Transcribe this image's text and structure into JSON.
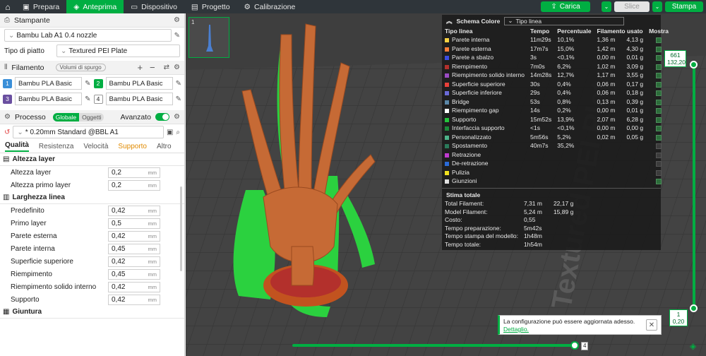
{
  "topbar": {
    "tabs": [
      {
        "label": "Prepara",
        "icon": "cube-icon"
      },
      {
        "label": "Anteprima",
        "icon": "layers-icon",
        "active": true
      },
      {
        "label": "Dispositivo",
        "icon": "monitor-icon"
      },
      {
        "label": "Progetto",
        "icon": "folder-icon"
      },
      {
        "label": "Calibrazione",
        "icon": "gear-icon"
      }
    ],
    "load_label": "Carica",
    "slice_label": "Slice",
    "print_label": "Stampa"
  },
  "printer": {
    "header": "Stampante",
    "name": "Bambu Lab A1 0.4 nozzle",
    "plate_label": "Tipo di piatto",
    "plate_value": "Textured PEI Plate"
  },
  "filament": {
    "header": "Filamento",
    "purge_label": "Volumi di spurgo",
    "items": [
      {
        "num": "1",
        "name": "Bambu PLA Basic",
        "color": "#3a8fd8",
        "text": "#fff"
      },
      {
        "num": "2",
        "name": "Bambu PLA Basic",
        "color": "#00ae42",
        "text": "#fff"
      },
      {
        "num": "3",
        "name": "Bambu PLA Basic",
        "color": "#6a4fa0",
        "text": "#fff"
      },
      {
        "num": "4",
        "name": "Bambu PLA Basic",
        "color": "#ffffff",
        "text": "#222"
      }
    ]
  },
  "process": {
    "header": "Processo",
    "toggle_global": "Globale",
    "toggle_objects": "Oggetti",
    "advanced_label": "Avanzato",
    "preset": "* 0.20mm Standard @BBL A1",
    "tabs": [
      "Qualità",
      "Resistenza",
      "Velocità",
      "Supporto",
      "Altro"
    ],
    "groups": [
      {
        "title": "Altezza layer",
        "rows": [
          {
            "label": "Altezza layer",
            "value": "0,2",
            "unit": "mm"
          },
          {
            "label": "Altezza primo layer",
            "value": "0,2",
            "unit": "mm"
          }
        ]
      },
      {
        "title": "Larghezza linea",
        "rows": [
          {
            "label": "Predefinito",
            "value": "0,42",
            "unit": "mm"
          },
          {
            "label": "Primo layer",
            "value": "0,5",
            "unit": "mm"
          },
          {
            "label": "Parete esterna",
            "value": "0,42",
            "unit": "mm"
          },
          {
            "label": "Parete interna",
            "value": "0,45",
            "unit": "mm"
          },
          {
            "label": "Superficie superiore",
            "value": "0,42",
            "unit": "mm"
          },
          {
            "label": "Riempimento",
            "value": "0,45",
            "unit": "mm"
          },
          {
            "label": "Riempimento solido interno",
            "value": "0,42",
            "unit": "mm"
          },
          {
            "label": "Supporto",
            "value": "0,42",
            "unit": "mm"
          }
        ]
      },
      {
        "title": "Giuntura",
        "rows": []
      }
    ]
  },
  "thumbnail": {
    "num": "1"
  },
  "legend": {
    "title": "Schema Colore",
    "mode": "Tipo linea",
    "headers": [
      "Tipo linea",
      "Tempo",
      "Percentuale",
      "Filamento usato",
      "Mostra"
    ],
    "rows": [
      {
        "name": "Parete interna",
        "color": "#f5d142",
        "time": "11m29s",
        "pct": "10,1%",
        "fil": "1,36 m",
        "g": "4,13 g",
        "show": true
      },
      {
        "name": "Parete esterna",
        "color": "#ff7d38",
        "time": "17m7s",
        "pct": "15,0%",
        "fil": "1,42 m",
        "g": "4,30 g",
        "show": true
      },
      {
        "name": "Parete a sbalzo",
        "color": "#3c4ce0",
        "time": "3s",
        "pct": "<0,1%",
        "fil": "0,00 m",
        "g": "0,01 g",
        "show": true
      },
      {
        "name": "Riempimento",
        "color": "#b3302c",
        "time": "7m0s",
        "pct": "6,2%",
        "fil": "1,02 m",
        "g": "3,09 g",
        "show": true
      },
      {
        "name": "Riempimento solido interno",
        "color": "#9a4bc4",
        "time": "14m28s",
        "pct": "12,7%",
        "fil": "1,17 m",
        "g": "3,55 g",
        "show": true
      },
      {
        "name": "Superficie superiore",
        "color": "#e8403a",
        "time": "30s",
        "pct": "0,4%",
        "fil": "0,06 m",
        "g": "0,17 g",
        "show": true
      },
      {
        "name": "Superficie inferiore",
        "color": "#6a6ad8",
        "time": "29s",
        "pct": "0,4%",
        "fil": "0,06 m",
        "g": "0,18 g",
        "show": true
      },
      {
        "name": "Bridge",
        "color": "#5b87a8",
        "time": "53s",
        "pct": "0,8%",
        "fil": "0,13 m",
        "g": "0,39 g",
        "show": true
      },
      {
        "name": "Riempimento gap",
        "color": "#ffffff",
        "time": "14s",
        "pct": "0,2%",
        "fil": "0,00 m",
        "g": "0,01 g",
        "show": true
      },
      {
        "name": "Supporto",
        "color": "#24c43c",
        "time": "15m52s",
        "pct": "13,9%",
        "fil": "2,07 m",
        "g": "6,28 g",
        "show": true
      },
      {
        "name": "Interfaccia supporto",
        "color": "#1b8a3a",
        "time": "<1s",
        "pct": "<0,1%",
        "fil": "0,00 m",
        "g": "0,00 g",
        "show": true
      },
      {
        "name": "Personalizzato",
        "color": "#4db38a",
        "time": "5m56s",
        "pct": "5,2%",
        "fil": "0,02 m",
        "g": "0,05 g",
        "show": true
      },
      {
        "name": "Spostamento",
        "color": "#2a7a5a",
        "time": "40m7s",
        "pct": "35,2%",
        "fil": "",
        "g": "",
        "show": false
      },
      {
        "name": "Retrazione",
        "color": "#c03ad0",
        "time": "",
        "pct": "",
        "fil": "",
        "g": "",
        "show": false
      },
      {
        "name": "De-retrazione",
        "color": "#2a6ad8",
        "time": "",
        "pct": "",
        "fil": "",
        "g": "",
        "show": false
      },
      {
        "name": "Pulizia",
        "color": "#f0e020",
        "time": "",
        "pct": "",
        "fil": "",
        "g": "",
        "show": false
      },
      {
        "name": "Giunzioni",
        "color": "#e0e0e0",
        "time": "",
        "pct": "",
        "fil": "",
        "g": "",
        "show": true
      }
    ],
    "estimate_title": "Stima totale",
    "estimate": [
      {
        "label": "Total Filament:",
        "v1": "7,31 m",
        "v2": "22,17 g"
      },
      {
        "label": "Model Filament:",
        "v1": "5,24 m",
        "v2": "15,89 g"
      },
      {
        "label": "Costo:",
        "v1": "0,55",
        "v2": ""
      },
      {
        "label": "Tempo preparazione:",
        "v1": "5m42s",
        "v2": ""
      },
      {
        "label": "Tempo stampa del modello:",
        "v1": "1h48m",
        "v2": ""
      },
      {
        "label": "Tempo totale:",
        "v1": "1h54m",
        "v2": ""
      }
    ]
  },
  "layer_slider": {
    "top_layer": "661",
    "top_height": "132,20",
    "bottom_layer": "1",
    "bottom_height": "0,20"
  },
  "move_slider": {
    "value": "4"
  },
  "bed_text": "Textured PEI Plate",
  "notification": {
    "message": "La configurazione può essere aggiornata adesso.",
    "link": "Dettaglio."
  }
}
